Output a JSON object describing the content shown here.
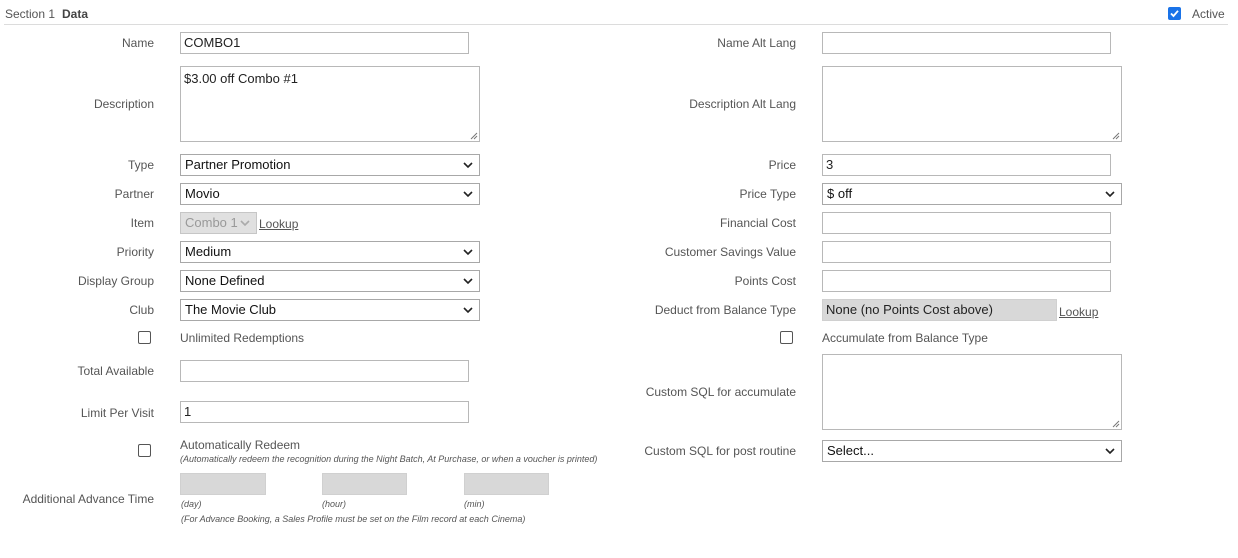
{
  "header": {
    "section_label": "Section 1",
    "section_title": "Data",
    "active_label": "Active",
    "active_checked": true
  },
  "left": {
    "name": {
      "label": "Name",
      "value": "COMBO1"
    },
    "description": {
      "label": "Description",
      "value": "$3.00 off Combo #1"
    },
    "type": {
      "label": "Type",
      "value": "Partner Promotion"
    },
    "partner": {
      "label": "Partner",
      "value": "Movio"
    },
    "item": {
      "label": "Item",
      "value": "Combo 1",
      "lookup": "Lookup"
    },
    "priority": {
      "label": "Priority",
      "value": "Medium"
    },
    "display_group": {
      "label": "Display Group",
      "value": "None Defined"
    },
    "club": {
      "label": "Club",
      "value": "The Movie Club"
    },
    "unlimited": {
      "label": "Unlimited Redemptions",
      "checked": false
    },
    "total_available": {
      "label": "Total Available",
      "value": ""
    },
    "limit_per_visit": {
      "label": "Limit Per Visit",
      "value": "1"
    },
    "auto_redeem": {
      "label": "Automatically Redeem",
      "note": "(Automatically redeem the recognition during the Night Batch, At Purchase, or when a voucher is printed)",
      "checked": false
    },
    "advance_time": {
      "label": "Additional Advance Time",
      "day_label": "(day)",
      "hour_label": "(hour)",
      "min_label": "(min)",
      "note": "(For Advance Booking, a Sales Profile must be set on the Film record at each Cinema)"
    }
  },
  "right": {
    "name_alt": {
      "label": "Name Alt Lang",
      "value": ""
    },
    "description_alt": {
      "label": "Description Alt Lang",
      "value": ""
    },
    "price": {
      "label": "Price",
      "value": "3"
    },
    "price_type": {
      "label": "Price Type",
      "value": "$ off"
    },
    "financial_cost": {
      "label": "Financial Cost",
      "value": ""
    },
    "customer_savings": {
      "label": "Customer Savings Value",
      "value": ""
    },
    "points_cost": {
      "label": "Points Cost",
      "value": ""
    },
    "deduct_balance": {
      "label": "Deduct from Balance Type",
      "value": "None (no Points Cost above)",
      "lookup": "Lookup"
    },
    "accumulate_balance": {
      "label": "Accumulate from Balance Type",
      "checked": false
    },
    "custom_sql_accumulate": {
      "label": "Custom SQL for accumulate",
      "value": ""
    },
    "custom_sql_post": {
      "label": "Custom SQL for post routine",
      "value": "Select..."
    }
  }
}
